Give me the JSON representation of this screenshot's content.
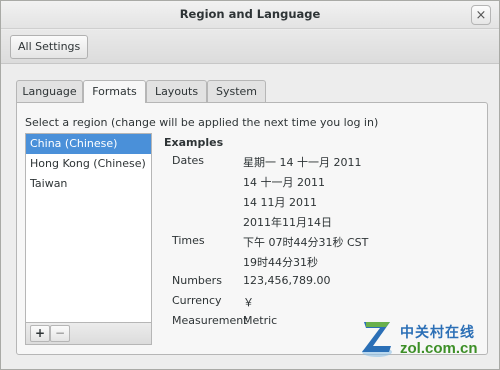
{
  "window": {
    "title": "Region and Language",
    "close_glyph": "×"
  },
  "toolbar": {
    "all_settings_label": "All Settings"
  },
  "tabs": [
    {
      "label": "Language",
      "active": false
    },
    {
      "label": "Formats",
      "active": true
    },
    {
      "label": "Layouts",
      "active": false
    },
    {
      "label": "System",
      "active": false
    }
  ],
  "formats": {
    "prompt": "Select a region (change will be applied the next time you log in)",
    "regions": [
      {
        "label": "China (Chinese)",
        "selected": true
      },
      {
        "label": "Hong Kong (Chinese)",
        "selected": false
      },
      {
        "label": "Taiwan",
        "selected": false
      }
    ],
    "add_label": "+",
    "remove_label": "−",
    "examples_title": "Examples",
    "dates_label": "Dates",
    "dates": [
      "星期一 14 十一月 2011",
      "14 十一月 2011",
      "14 11月 2011",
      "2011年11月14日"
    ],
    "times_label": "Times",
    "times": [
      "下午 07时44分31秒 CST",
      "19时44分31秒"
    ],
    "numbers_label": "Numbers",
    "numbers_value": "123,456,789.00",
    "currency_label": "Currency",
    "currency_value": "￥",
    "measurement_label": "Measurement",
    "measurement_value": "Metric"
  },
  "watermark": {
    "cn_text": "中关村在线",
    "url_text": "zol.com.cn"
  },
  "colors": {
    "selection": "#4a90d9",
    "watermark_blue": "#2b6fb6",
    "watermark_green": "#3d8f27"
  }
}
